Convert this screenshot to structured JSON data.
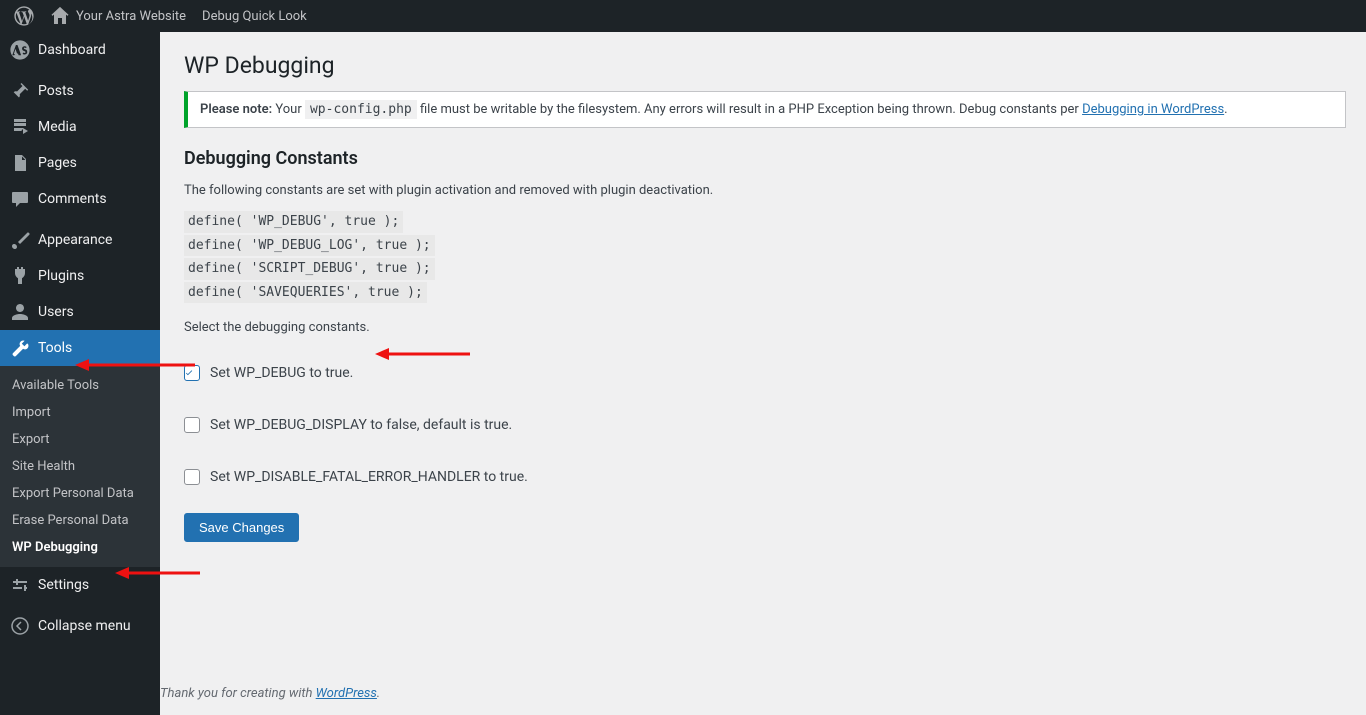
{
  "adminbar": {
    "site_name": "Your Astra Website",
    "quick_look": "Debug Quick Look"
  },
  "sidebar": {
    "items": [
      {
        "id": "dashboard",
        "label": "Dashboard"
      },
      {
        "id": "posts",
        "label": "Posts"
      },
      {
        "id": "media",
        "label": "Media"
      },
      {
        "id": "pages",
        "label": "Pages"
      },
      {
        "id": "comments",
        "label": "Comments"
      },
      {
        "id": "appearance",
        "label": "Appearance"
      },
      {
        "id": "plugins",
        "label": "Plugins"
      },
      {
        "id": "users",
        "label": "Users"
      },
      {
        "id": "tools",
        "label": "Tools"
      },
      {
        "id": "settings",
        "label": "Settings"
      },
      {
        "id": "collapse",
        "label": "Collapse menu"
      }
    ],
    "tools_submenu": [
      {
        "label": "Available Tools"
      },
      {
        "label": "Import"
      },
      {
        "label": "Export"
      },
      {
        "label": "Site Health"
      },
      {
        "label": "Export Personal Data"
      },
      {
        "label": "Erase Personal Data"
      },
      {
        "label": "WP Debugging",
        "current": true
      }
    ]
  },
  "page": {
    "title": "WP Debugging",
    "notice_strong": "Please note:",
    "notice_text_1": " Your ",
    "notice_code": "wp-config.php",
    "notice_text_2": " file must be writable by the filesystem. Any errors will result in a PHP Exception being thrown. Debug constants per ",
    "notice_link_text": "Debugging in WordPress",
    "notice_text_3": ".",
    "section_heading": "Debugging Constants",
    "intro": "The following constants are set with plugin activation and removed with plugin deactivation.",
    "code_lines": [
      "define( 'WP_DEBUG', true );",
      "define( 'WP_DEBUG_LOG', true );",
      "define( 'SCRIPT_DEBUG', true );",
      "define( 'SAVEQUERIES', true );"
    ],
    "select_prompt": "Select the debugging constants.",
    "checkboxes": [
      {
        "label": "Set WP_DEBUG to true.",
        "checked": true
      },
      {
        "label": "Set WP_DEBUG_DISPLAY to false, default is true.",
        "checked": false
      },
      {
        "label": "Set WP_DISABLE_FATAL_ERROR_HANDLER to true.",
        "checked": false
      }
    ],
    "save_label": "Save Changes",
    "footer_prefix": "Thank you for creating with ",
    "footer_link": "WordPress",
    "footer_suffix": "."
  }
}
